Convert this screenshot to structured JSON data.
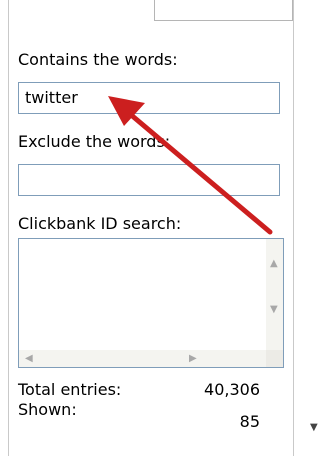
{
  "fields": {
    "contains_label": "Contains the words:",
    "contains_value": "twitter",
    "exclude_label": "Exclude the words:",
    "exclude_value": "",
    "clickbank_label": "Clickbank ID search:"
  },
  "stats": {
    "total_label": "Total entries:",
    "total_value": "40,306",
    "shown_label": "Shown:",
    "shown_value": "85"
  },
  "colors": {
    "annotation_arrow": "#cc1f1f",
    "field_border": "#7f9db9"
  },
  "icons": {
    "scroll_up": "scroll-up-icon",
    "scroll_down": "scroll-down-icon",
    "scroll_left": "scroll-left-icon",
    "scroll_right": "scroll-right-icon",
    "outer_scroll_down": "scroll-down-icon"
  }
}
